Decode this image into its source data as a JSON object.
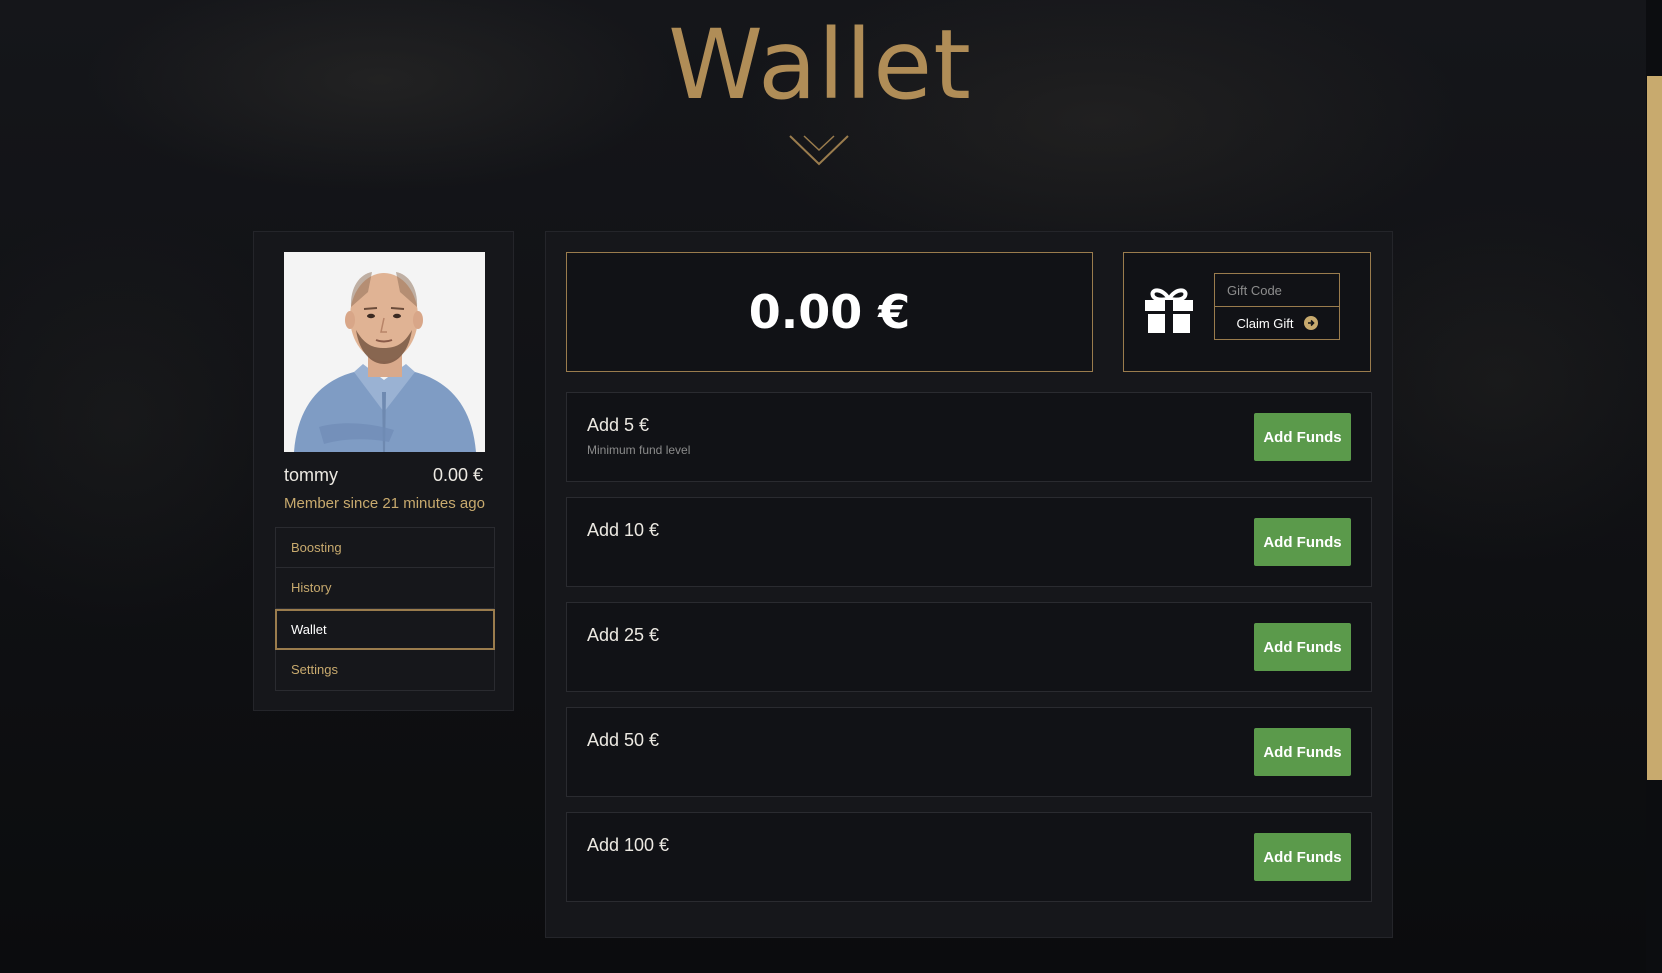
{
  "page": {
    "title": "Wallet"
  },
  "profile": {
    "username": "tommy",
    "balance": "0.00 €",
    "member_since": "Member since 21 minutes ago",
    "nav": [
      {
        "label": "Boosting",
        "active": false
      },
      {
        "label": "History",
        "active": false
      },
      {
        "label": "Wallet",
        "active": true
      },
      {
        "label": "Settings",
        "active": false
      }
    ]
  },
  "wallet": {
    "balance": "0.00 €",
    "gift": {
      "placeholder": "Gift Code",
      "claim_label": "Claim Gift"
    },
    "funds": [
      {
        "label": "Add 5 €",
        "note": "Minimum fund level",
        "button": "Add Funds"
      },
      {
        "label": "Add 10 €",
        "note": "",
        "button": "Add Funds"
      },
      {
        "label": "Add 25 €",
        "note": "",
        "button": "Add Funds"
      },
      {
        "label": "Add 50 €",
        "note": "",
        "button": "Add Funds"
      },
      {
        "label": "Add 100 €",
        "note": "",
        "button": "Add Funds"
      }
    ]
  },
  "colors": {
    "accent_gold": "#c8aa6e",
    "title_gold": "#b08d57",
    "button_green": "#5b9a4b",
    "background": "#0e0f12",
    "panel": "#16171b"
  },
  "icons": {
    "gift": "gift-icon",
    "claim_arrow": "arrow-circle-right-icon"
  }
}
